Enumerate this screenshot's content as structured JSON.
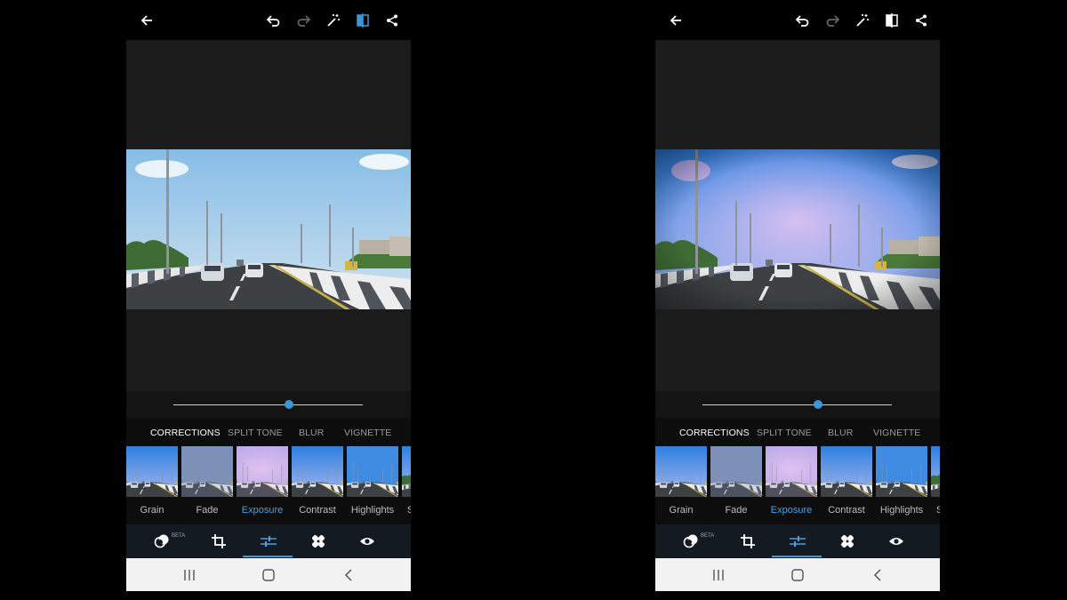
{
  "editor": {
    "category_tabs": [
      "CORRECTIONS",
      "SPLIT TONE",
      "BLUR",
      "VIGNETTE"
    ],
    "active_tab": "CORRECTIONS",
    "adjustments": [
      "Grain",
      "Fade",
      "Exposure",
      "Contrast",
      "Highlights",
      "S"
    ],
    "active_adjustment": "Exposure",
    "beta_label": "BETA",
    "slider_value_fraction": 0.61,
    "icons": {
      "topbar": [
        "back-arrow-icon",
        "undo-icon",
        "redo-icon",
        "auto-fix-wand-icon",
        "compare-icon",
        "share-icon"
      ],
      "toolbar": [
        "looks-icon",
        "crop-icon",
        "adjustments-icon",
        "heal-icon",
        "preview-eye-icon"
      ],
      "navbar": [
        "recents-icon",
        "home-icon",
        "back-icon"
      ]
    },
    "colors": {
      "accent": "#3d95d6",
      "inactive_tab": "#9a9a9a"
    }
  },
  "phones": [
    {
      "id": "before"
    },
    {
      "id": "after"
    }
  ]
}
